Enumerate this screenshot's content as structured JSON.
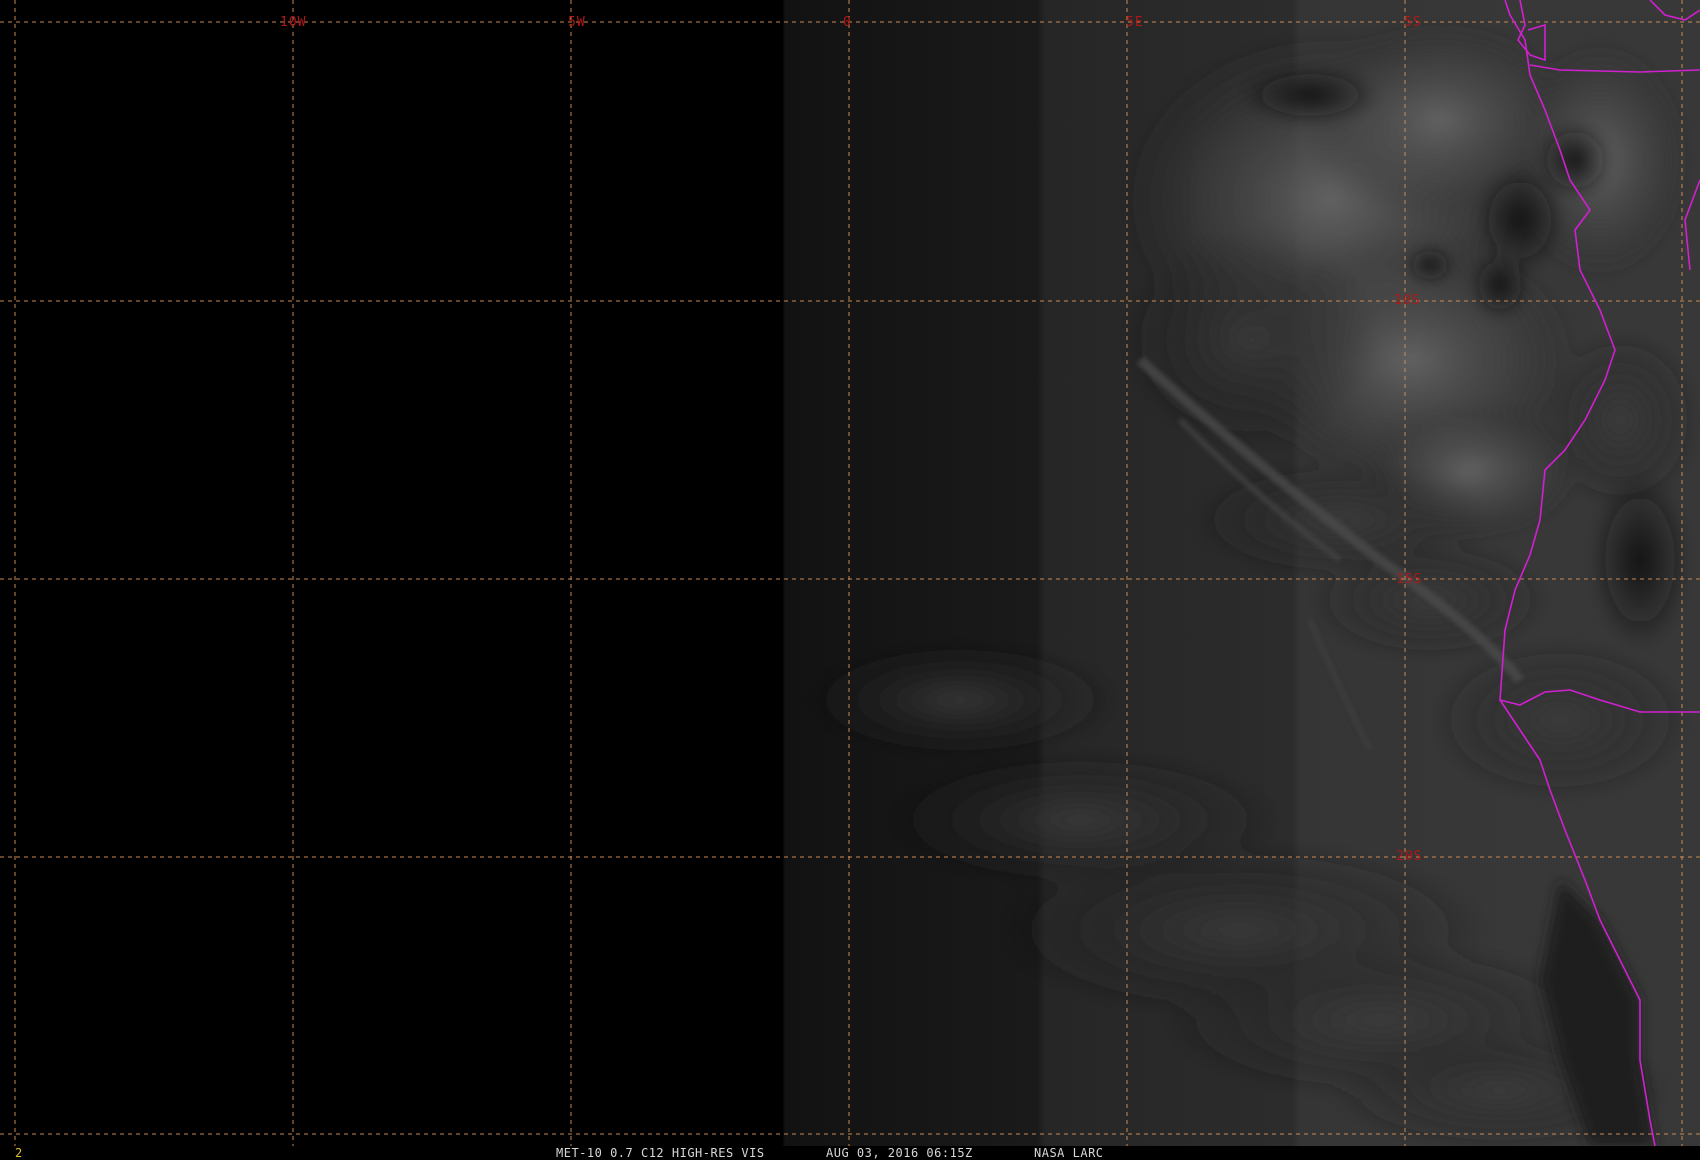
{
  "map": {
    "longitude_labels": [
      "10W",
      "5W",
      "0",
      "5E",
      "5S"
    ],
    "latitude_labels": [
      "10S",
      "15S",
      "20S"
    ],
    "colors": {
      "background": "#000000",
      "graticule": "#c98a55",
      "grid_label": "#b01818",
      "coastline": "#d020d0",
      "status_text": "#d8d8d8",
      "frame_number": "#e0c020"
    }
  },
  "status_bar": {
    "frame_number": "2",
    "satellite_product": "MET-10 0.7 C12 HIGH-RES VIS",
    "timestamp": "AUG 03, 2016 06:15Z",
    "institution": "NASA LARC"
  }
}
